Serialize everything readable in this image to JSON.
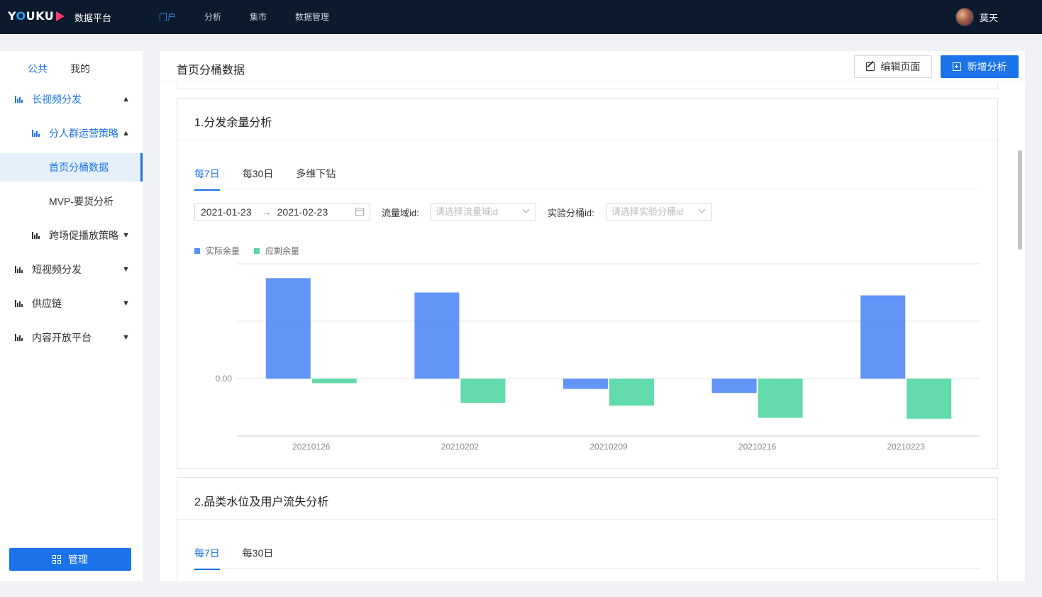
{
  "topbar": {
    "logo_text": "YOUKU",
    "platform_name": "数据平台",
    "nav": [
      {
        "label": "门户",
        "active": true
      },
      {
        "label": "分析",
        "active": false
      },
      {
        "label": "集市",
        "active": false
      },
      {
        "label": "数据管理",
        "active": false
      }
    ],
    "user_name": "莫天"
  },
  "sidebar": {
    "tabs": [
      {
        "label": "公共",
        "active": true
      },
      {
        "label": "我的",
        "active": false
      }
    ],
    "items": [
      {
        "label": "长视频分发",
        "icon": "bar-chart-icon",
        "expanded": true
      },
      {
        "label": "分人群运营策略",
        "icon": "bar-chart-icon",
        "expanded": true
      },
      {
        "label": "首页分桶数据",
        "selected": true
      },
      {
        "label": "MVP-要货分析"
      },
      {
        "label": "跨场促播放策略",
        "icon": "bar-chart-icon",
        "expanded": false
      },
      {
        "label": "短视频分发",
        "icon": "bar-chart-icon",
        "expanded": false
      },
      {
        "label": "供应链",
        "icon": "bar-chart-icon",
        "expanded": false
      },
      {
        "label": "内容开放平台",
        "icon": "bar-chart-icon",
        "expanded": false
      }
    ],
    "manage_label": "管理"
  },
  "main": {
    "title": "首页分桶数据",
    "edit_label": "编辑页面",
    "add_label": "新增分析",
    "card1": {
      "title": "1.分发余量分析",
      "tabs": [
        {
          "label": "每7日",
          "active": true
        },
        {
          "label": "每30日",
          "active": false
        },
        {
          "label": "多维下钻",
          "active": false
        }
      ],
      "date_start": "2021-01-23",
      "date_arrow": "→",
      "date_end": "2021-02-23",
      "filter1_label": "流量域id",
      "filter1_placeholder": "请选择流量域id",
      "filter2_label": "实验分桶id",
      "filter2_placeholder": "请选择实验分桶id"
    },
    "card2": {
      "title": "2.品类水位及用户流失分析",
      "tabs": [
        {
          "label": "每7日",
          "active": true
        },
        {
          "label": "每30日",
          "active": false
        }
      ]
    }
  },
  "colors": {
    "primary": "#1a73e8",
    "series_actual": "#5b8ff9",
    "series_expected": "#5ad8a6",
    "topbar_bg": "#0b1a2d"
  },
  "chart_data": {
    "type": "bar",
    "categories": [
      "20210126",
      "20210202",
      "20210209",
      "20210216",
      "20210223"
    ],
    "series": [
      {
        "name": "实际余量",
        "values": [
          1.75,
          1.5,
          -0.18,
          -0.25,
          1.45
        ]
      },
      {
        "name": "应剩余量",
        "values": [
          -0.08,
          -0.42,
          -0.47,
          -0.68,
          -0.7
        ]
      }
    ],
    "y_tick_labels": [
      "0.00"
    ],
    "ylim": [
      -1,
      2
    ],
    "grid": true,
    "legend_position": "top-left"
  }
}
